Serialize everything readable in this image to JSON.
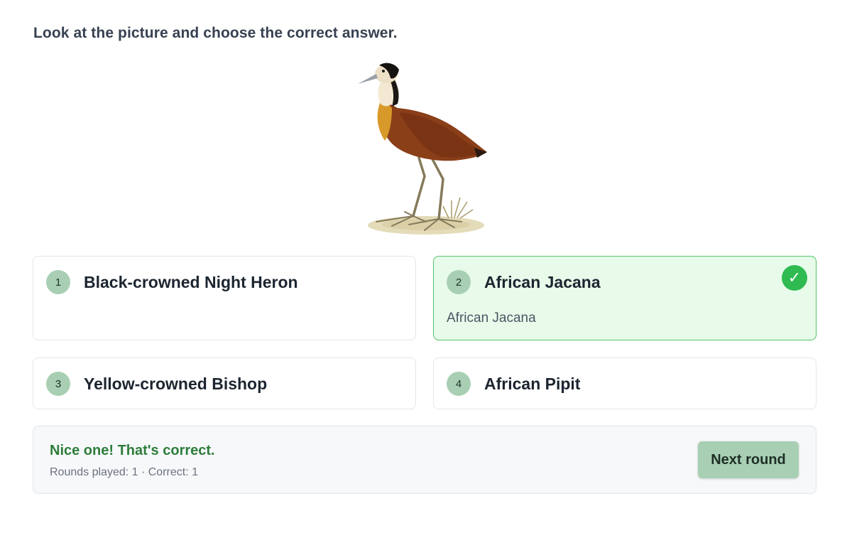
{
  "prompt": "Look at the picture and choose the correct answer.",
  "options": [
    {
      "number": "1",
      "label": "Black-crowned Night Heron",
      "state": "default"
    },
    {
      "number": "2",
      "label": "African Jacana",
      "sublabel": "African Jacana",
      "state": "correct",
      "icon": "checkmark-icon",
      "check_glyph": "✓"
    },
    {
      "number": "3",
      "label": "Yellow-crowned Bishop",
      "state": "default"
    },
    {
      "number": "4",
      "label": "African Pipit",
      "state": "default"
    }
  ],
  "feedback": {
    "title": "Nice one! That's correct.",
    "stats": "Rounds played: 1 · Correct: 1",
    "next_label": "Next round"
  },
  "colors": {
    "accent": "#a8cfb3",
    "correct_border": "#53c36b",
    "correct_bg": "#e8fbea",
    "check_green": "#2fba52",
    "feedback_text": "#2e7d3a"
  }
}
